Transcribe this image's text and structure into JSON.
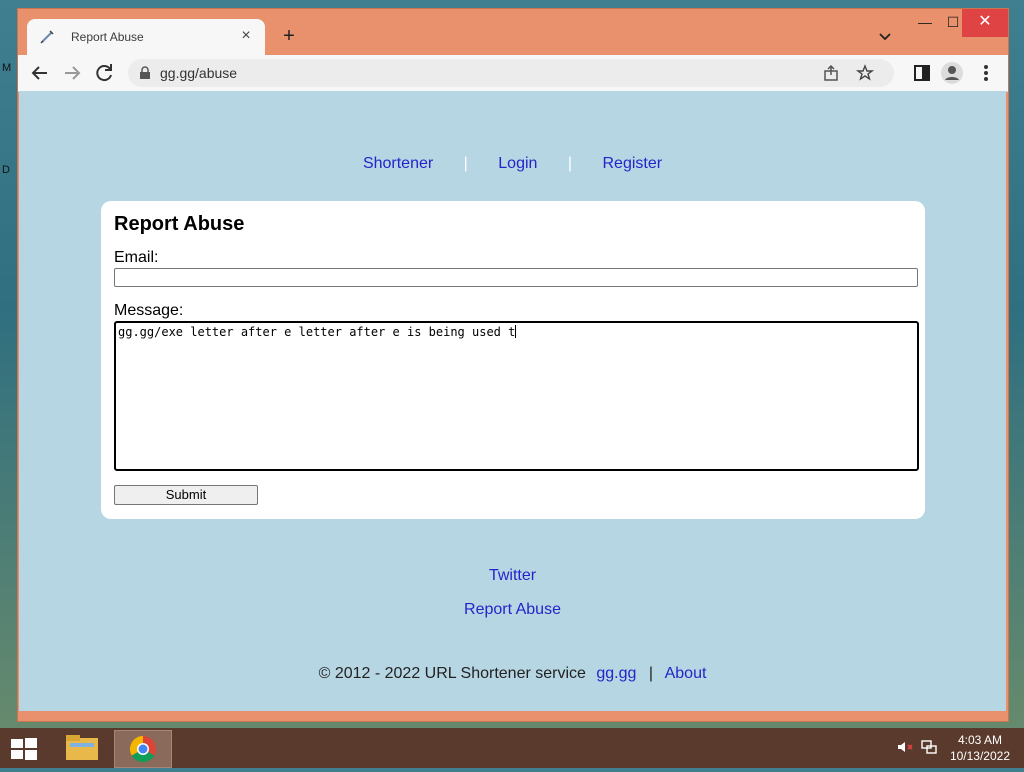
{
  "desktop": {
    "edge_glyph_1": "M",
    "edge_glyph_2": "D"
  },
  "window": {
    "tab_title": "Report Abuse",
    "url": "gg.gg/abuse",
    "minimize_label": "—",
    "maximize_label": "☐",
    "close_label": "✕"
  },
  "page": {
    "nav": {
      "shortener": "Shortener",
      "sep": "|",
      "login": "Login",
      "register": "Register"
    },
    "form": {
      "title": "Report Abuse",
      "email_label": "Email:",
      "email_value": "",
      "message_label": "Message:",
      "message_value": "gg.gg/exe letter after e letter after e is being used t",
      "submit_label": "Submit"
    },
    "footer": {
      "twitter": "Twitter",
      "report_abuse": "Report Abuse",
      "copyright_text": "© 2012 - 2022 URL Shortener service",
      "site_link": "gg.gg",
      "sep": "|",
      "about": "About"
    }
  },
  "taskbar": {
    "time": "4:03 AM",
    "date": "10/13/2022"
  },
  "colors": {
    "link": "#2424c8",
    "page_bg": "#b7d6e3",
    "window_frame": "#e9906c"
  }
}
